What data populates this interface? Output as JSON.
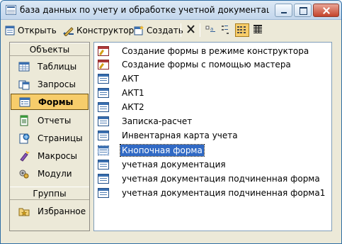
{
  "window": {
    "title": "база данных по учету и обработке учетной документации на ..."
  },
  "toolbar": {
    "open_label": "Открыть",
    "design_label": "Конструктор",
    "create_label": "Создать"
  },
  "objects_panel": {
    "header": "Объекты",
    "items": [
      {
        "label": "Таблицы",
        "icon": "table-icon"
      },
      {
        "label": "Запросы",
        "icon": "query-icon"
      },
      {
        "label": "Формы",
        "icon": "form-icon"
      },
      {
        "label": "Отчеты",
        "icon": "report-icon"
      },
      {
        "label": "Страницы",
        "icon": "page-icon"
      },
      {
        "label": "Макросы",
        "icon": "macro-icon"
      },
      {
        "label": "Модули",
        "icon": "module-icon"
      }
    ],
    "groups_header": "Группы",
    "groups": [
      {
        "label": "Избранное",
        "icon": "favorites-folder-icon"
      }
    ],
    "selected": "Формы"
  },
  "forms_list": {
    "items": [
      {
        "label": "Создание формы в режиме конструктора",
        "icon": "design-form-icon"
      },
      {
        "label": "Создание формы с помощью мастера",
        "icon": "wizard-icon"
      },
      {
        "label": "АКТ",
        "icon": "form-icon"
      },
      {
        "label": "АКТ1",
        "icon": "form-icon"
      },
      {
        "label": "АКТ2",
        "icon": "form-icon"
      },
      {
        "label": "Записка-расчет",
        "icon": "form-icon"
      },
      {
        "label": "Инвентарная карта учета",
        "icon": "form-icon"
      },
      {
        "label": "Кнопочная форма",
        "icon": "form-icon"
      },
      {
        "label": "учетная документация",
        "icon": "form-icon"
      },
      {
        "label": "учетная документация подчиненная форма",
        "icon": "form-icon"
      },
      {
        "label": "учетная документация подчиненная форма1",
        "icon": "form-icon"
      }
    ],
    "selected": "Кнопочная форма"
  }
}
